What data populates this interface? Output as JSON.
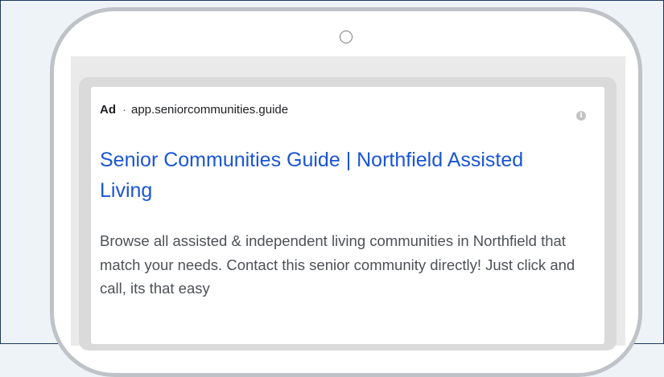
{
  "ad": {
    "badge": "Ad",
    "separator": "·",
    "display_url": "app.seniorcommunities.guide",
    "info_icon": "info-icon",
    "headline": "Senior Communities Guide | Northfield Assisted Living",
    "description": "Browse all assisted & independent living communities in Northfield that match your needs. Contact this senior community directly! Just click and call, its that easy"
  },
  "colors": {
    "headline_link": "#1a55d6",
    "body_text": "#4d5156",
    "device_frame": "#bfc3c8",
    "outer_border": "#1f3763"
  }
}
